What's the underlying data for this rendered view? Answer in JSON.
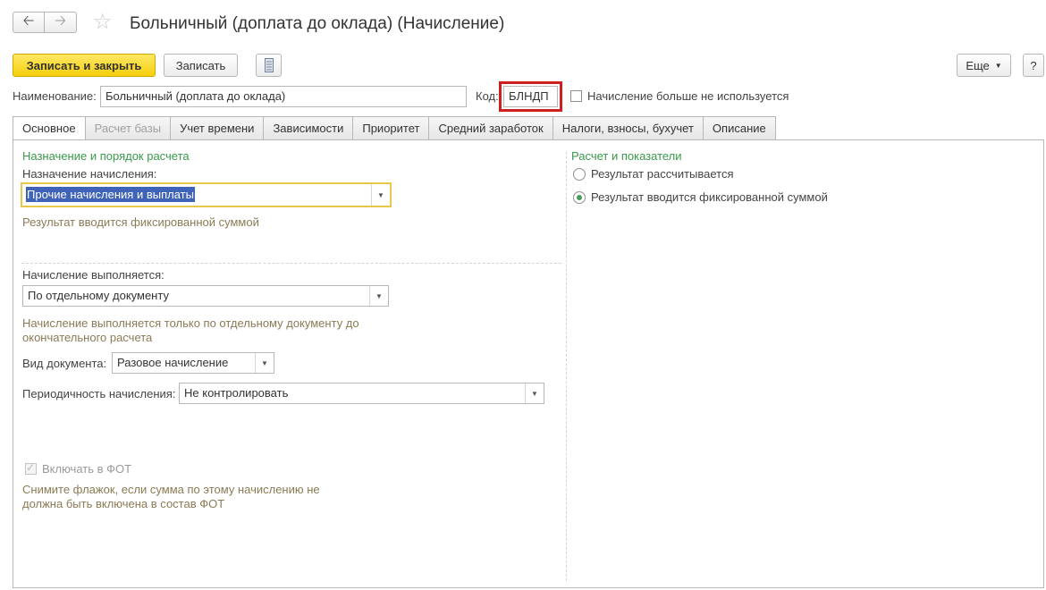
{
  "window": {
    "title": "Больничный (доплата до оклада) (Начисление)",
    "nav_back_icon": "arrow-left-icon",
    "nav_forward_icon": "arrow-right-icon",
    "favorite_icon": "star-icon"
  },
  "toolbar": {
    "save_close_label": "Записать и закрыть",
    "save_label": "Записать",
    "report_icon": "document-list-icon",
    "more_label": "Еще",
    "help_label": "?"
  },
  "header": {
    "name_label": "Наименование:",
    "name_value": "Больничный (доплата до оклада)",
    "code_label": "Код:",
    "code_value": "БЛНДП",
    "unused_label": "Начисление больше не используется",
    "unused_checked": false
  },
  "tabs": [
    {
      "label": "Основное",
      "state": "active"
    },
    {
      "label": "Расчет базы",
      "state": "disabled"
    },
    {
      "label": "Учет времени",
      "state": "normal"
    },
    {
      "label": "Зависимости",
      "state": "normal"
    },
    {
      "label": "Приоритет",
      "state": "normal"
    },
    {
      "label": "Средний заработок",
      "state": "normal"
    },
    {
      "label": "Налоги, взносы, бухучет",
      "state": "normal"
    },
    {
      "label": "Описание",
      "state": "normal"
    }
  ],
  "left": {
    "section_title": "Назначение и порядок расчета",
    "purpose_label": "Назначение начисления:",
    "purpose_value": "Прочие начисления и выплаты",
    "purpose_hint": "Результат вводится фиксированной суммой",
    "performed_label": "Начисление выполняется:",
    "performed_value": "По отдельному документу",
    "performed_hint": "Начисление выполняется только по отдельному документу до окончательного расчета",
    "doc_type_label": "Вид документа:",
    "doc_type_value": "Разовое начисление",
    "periodicity_label": "Периодичность начисления:",
    "periodicity_value": "Не контролировать",
    "fot_label": "Включать в ФОТ",
    "fot_checked": true,
    "fot_hint": "Снимите флажок, если сумма по этому начислению не должна быть включена в состав ФОТ"
  },
  "right": {
    "section_title": "Расчет и показатели",
    "option_calculated": "Результат рассчитывается",
    "option_fixed": "Результат вводится фиксированной суммой",
    "selected": "option_fixed"
  },
  "colors": {
    "primary_button": "#f5cf0b",
    "highlight_border": "#cc1f1f",
    "section_title": "#3a9a4a",
    "hint_text": "#8b7b55",
    "focus_border": "#e8c84a",
    "selection_bg": "#3f63b8"
  }
}
